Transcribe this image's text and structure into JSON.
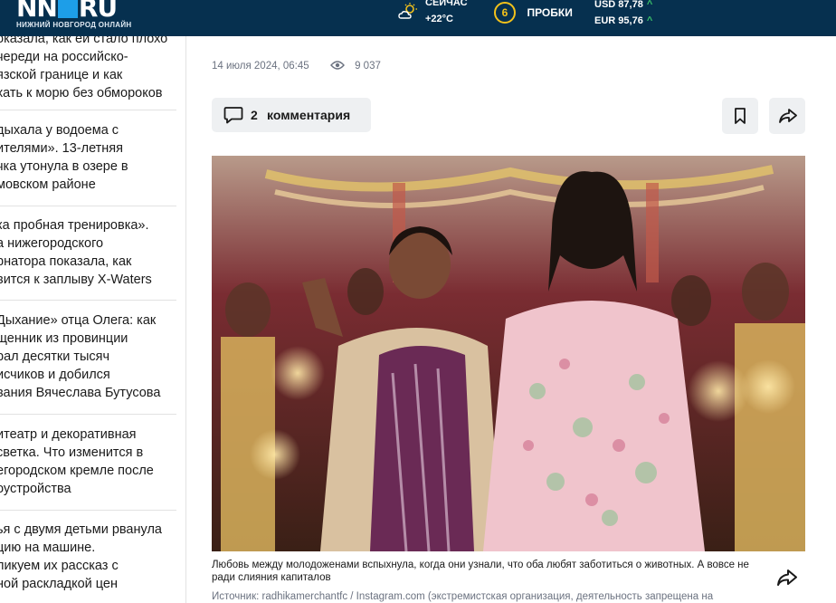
{
  "header": {
    "logo_text": "NN",
    "logo_suffix": "RU",
    "logo_subtitle": "НИЖНИЙ НОВГОРОД ОНЛАЙН",
    "weather_label": "СЕЙЧАС",
    "weather_temp": "+22°С",
    "weather_icon": "sun-cloud-icon",
    "traffic_score": "6",
    "traffic_label": "ПРОБКИ",
    "usd": "USD 87,78",
    "eur": "EUR 95,76",
    "trend_arrow": "^",
    "colors": {
      "bar": "#06304f",
      "traffic": "#f3c21b",
      "trend_up": "#3cc46b",
      "logo_accent": "#1d9ee8"
    }
  },
  "news_list": [
    {
      "lines": [
        "оказала, как ей стало плохо",
        "череди на российско-",
        "язской границе и как",
        "хать к морю без обмороков"
      ]
    },
    {
      "lines": [
        "дыхала у водоема с",
        "ителями». 13-летняя",
        "чка утонула в озере в",
        "мовском районе"
      ]
    },
    {
      "lines": [
        "ка пробная тренировка».",
        "а нижегородского",
        "рнатора показала, как",
        "вится к заплыву X-Waters"
      ]
    },
    {
      "lines": [
        "Дыхание» отца Олега: как",
        "щенник из провинции",
        "рал десятки тысяч",
        "исчиков и добился",
        "вания Вячеслава Бутусова"
      ]
    },
    {
      "lines": [
        "итеатр и декоративная",
        "светка. Что изменится в",
        "егородском кремле после",
        "оустройства"
      ]
    },
    {
      "lines": [
        "ья с двумя детьми рванула",
        "цию на машине.",
        "ликуем их рассказ с",
        "ной раскладкой цен"
      ]
    }
  ],
  "article": {
    "date": "14 июля 2024, 06:45",
    "views": "9 037",
    "comments_count": "2",
    "comments_label": "комментария",
    "caption": "Любовь между молодоженами вспыхнула, когда они узнали, что оба любят заботиться о животных. А вовсе не ради слияния капиталов",
    "source": "Источник: radhikamerchantfc / Instagram.com (экстремистская организация, деятельность запрещена на"
  },
  "icons": [
    "eye-icon",
    "comment-icon",
    "bookmark-icon",
    "share-icon"
  ]
}
